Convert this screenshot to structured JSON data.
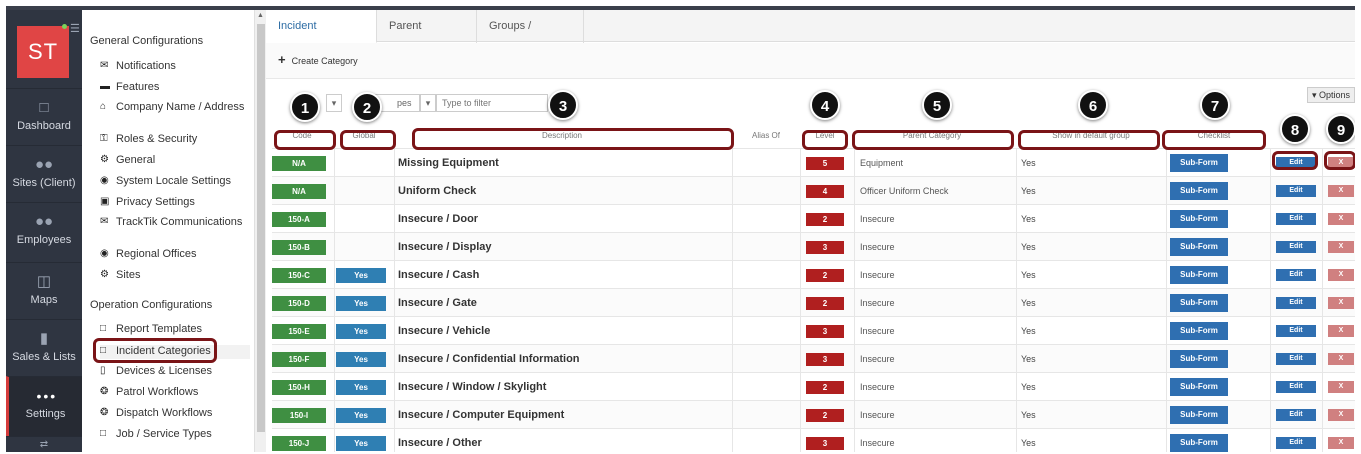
{
  "logo": {
    "text": "ST"
  },
  "nav": [
    {
      "label": "Dashboard",
      "icon": "monitor-icon"
    },
    {
      "label": "Sites (Client)",
      "icon": "group-icon"
    },
    {
      "label": "Employees",
      "icon": "people-icon"
    },
    {
      "label": "Maps",
      "icon": "map-icon"
    },
    {
      "label": "Sales & Lists",
      "icon": "bar-chart-icon"
    },
    {
      "label": "Settings",
      "icon": "ellipsis-icon",
      "active": true
    }
  ],
  "config": {
    "general_heading": "General Configurations",
    "general_items": [
      {
        "label": "Notifications",
        "icon": "envelope-icon"
      },
      {
        "label": "Features",
        "icon": "briefcase-icon"
      },
      {
        "label": "Company Name / Address",
        "icon": "home-icon"
      },
      {
        "label": "Roles & Security",
        "icon": "key-icon"
      },
      {
        "label": "General",
        "icon": "gear-icon"
      },
      {
        "label": "System Locale Settings",
        "icon": "globe-icon"
      },
      {
        "label": "Privacy Settings",
        "icon": "lock-icon"
      },
      {
        "label": "TrackTik Communications",
        "icon": "envelope-icon"
      },
      {
        "label": "Regional Offices",
        "icon": "globe-icon"
      },
      {
        "label": "Sites",
        "icon": "gear-icon"
      }
    ],
    "operation_heading": "Operation Configurations",
    "operation_items": [
      {
        "label": "Report Templates",
        "icon": "document-icon"
      },
      {
        "label": "Incident Categories",
        "icon": "document-icon",
        "selected": true
      },
      {
        "label": "Devices & Licenses",
        "icon": "mobile-icon"
      },
      {
        "label": "Patrol Workflows",
        "icon": "dribbble-icon"
      },
      {
        "label": "Dispatch Workflows",
        "icon": "dribbble-icon"
      },
      {
        "label": "Job / Service Types",
        "icon": "document-icon"
      }
    ]
  },
  "tabs": [
    "Incident Categories",
    "Parent Categories",
    "Groups / Industries"
  ],
  "toolbar": {
    "create_label": "Create Category",
    "options_label": "Options"
  },
  "filters": {
    "types_fragment": "pes",
    "placeholder": "Type to filter"
  },
  "columns": {
    "code": "Code",
    "global": "Global",
    "description": "Description",
    "alias": "Alias Of",
    "level": "Level",
    "parent": "Parent Category",
    "default_group": "Show in default group",
    "checklist": "Checklist"
  },
  "buttons": {
    "subform": "Sub-Form",
    "edit": "Edit",
    "delete": "X"
  },
  "rows": [
    {
      "code": "N/A",
      "global": "",
      "description": "Missing Equipment",
      "level": "5",
      "parent": "Equipment",
      "default_group": "Yes"
    },
    {
      "code": "N/A",
      "global": "",
      "description": "Uniform Check",
      "level": "4",
      "parent": "Officer Uniform Check",
      "default_group": "Yes"
    },
    {
      "code": "150-A",
      "global": "",
      "description": "Insecure / Door",
      "level": "2",
      "parent": "Insecure",
      "default_group": "Yes"
    },
    {
      "code": "150-B",
      "global": "",
      "description": "Insecure / Display",
      "level": "3",
      "parent": "Insecure",
      "default_group": "Yes"
    },
    {
      "code": "150-C",
      "global": "Yes",
      "description": "Insecure / Cash",
      "level": "2",
      "parent": "Insecure",
      "default_group": "Yes"
    },
    {
      "code": "150-D",
      "global": "Yes",
      "description": "Insecure / Gate",
      "level": "2",
      "parent": "Insecure",
      "default_group": "Yes"
    },
    {
      "code": "150-E",
      "global": "Yes",
      "description": "Insecure / Vehicle",
      "level": "3",
      "parent": "Insecure",
      "default_group": "Yes"
    },
    {
      "code": "150-F",
      "global": "Yes",
      "description": "Insecure / Confidential Information",
      "level": "3",
      "parent": "Insecure",
      "default_group": "Yes"
    },
    {
      "code": "150-H",
      "global": "Yes",
      "description": "Insecure / Window / Skylight",
      "level": "2",
      "parent": "Insecure",
      "default_group": "Yes"
    },
    {
      "code": "150-I",
      "global": "Yes",
      "description": "Insecure / Computer Equipment",
      "level": "2",
      "parent": "Insecure",
      "default_group": "Yes"
    },
    {
      "code": "150-J",
      "global": "Yes",
      "description": "Insecure / Other",
      "level": "3",
      "parent": "Insecure",
      "default_group": "Yes"
    }
  ],
  "callouts": [
    "1",
    "2",
    "3",
    "4",
    "5",
    "6",
    "7",
    "8",
    "9"
  ]
}
